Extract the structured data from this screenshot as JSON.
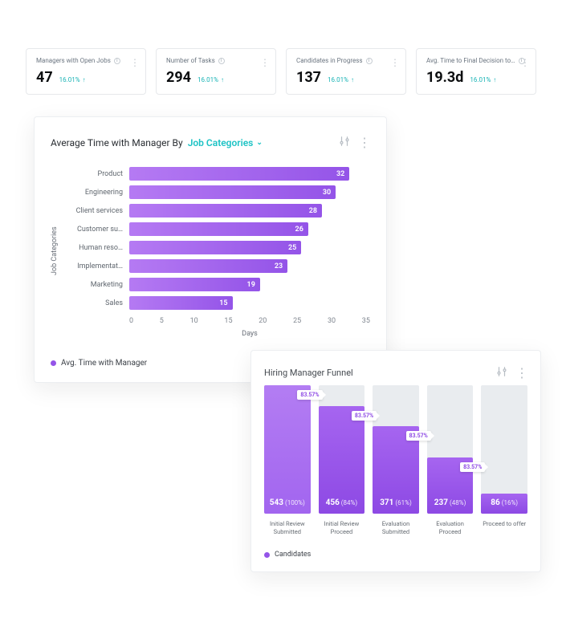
{
  "kpis": [
    {
      "title": "Managers with Open Jobs",
      "value": "47",
      "delta": "16.01%"
    },
    {
      "title": "Number of Tasks",
      "value": "294",
      "delta": "16.01%"
    },
    {
      "title": "Candidates in Progress",
      "value": "137",
      "delta": "16.01%"
    },
    {
      "title": "Avg. Time to Final Decision to…",
      "value": "19.3d",
      "delta": "16.01%"
    }
  ],
  "bar_chart": {
    "title_prefix": "Average Time with Manager By",
    "dropdown": "Job Categories",
    "y_axis_label": "Job Categories",
    "x_axis_label": "Days",
    "legend": "Avg. Time with Manager"
  },
  "funnel": {
    "title": "Hiring Manager Funnel",
    "legend": "Candidates",
    "badge": "83.57%"
  },
  "chart_data": [
    {
      "type": "bar",
      "orientation": "horizontal",
      "title": "Average Time with Manager By Job Categories",
      "xlabel": "Days",
      "ylabel": "Job Categories",
      "xlim": [
        0,
        35
      ],
      "x_ticks": [
        0,
        5,
        10,
        15,
        20,
        25,
        30,
        35
      ],
      "categories": [
        "Product",
        "Engineering",
        "Client services",
        "Customer su…",
        "Human reso…",
        "Implementat…",
        "Marketing",
        "Sales"
      ],
      "values": [
        32,
        30,
        28,
        26,
        25,
        23,
        19,
        15
      ],
      "series_name": "Avg. Time with Manager"
    },
    {
      "type": "bar",
      "title": "Hiring Manager Funnel",
      "ylabel": "Candidates",
      "ylim": [
        0,
        543
      ],
      "categories": [
        "Initial Review Submitted",
        "Initial Review Proceed",
        "Evaluation Submitted",
        "Evaluation Proceed",
        "Proceed to offer"
      ],
      "values": [
        543,
        456,
        371,
        237,
        86
      ],
      "percent_labels": [
        "100%",
        "84%",
        "61%",
        "48%",
        "16%"
      ],
      "transition_labels": [
        "83.57%",
        "83.57%",
        "83.57%",
        "83.57%"
      ],
      "series_name": "Candidates"
    }
  ]
}
